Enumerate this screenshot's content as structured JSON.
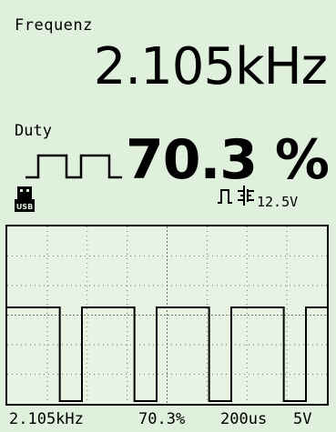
{
  "frequency": {
    "label": "Frequenz",
    "value": "2.105kHz"
  },
  "duty": {
    "label": "Duty",
    "value": "70.3 %"
  },
  "indicators": {
    "usb_icon": "usb-icon",
    "edge_icon": "rising-edge-icon",
    "coupling_icon": "dc-coupling-icon",
    "voltage": "12.5V"
  },
  "scope": {
    "grid": true,
    "waveform": "square",
    "duty_cycle_percent": 70.3
  },
  "status": {
    "frequency": "2.105kHz",
    "duty": "70.3%",
    "timebase": "200us",
    "volts_per_div": "5V"
  },
  "colors": {
    "background": "#dff1dc",
    "foreground": "#000000"
  }
}
